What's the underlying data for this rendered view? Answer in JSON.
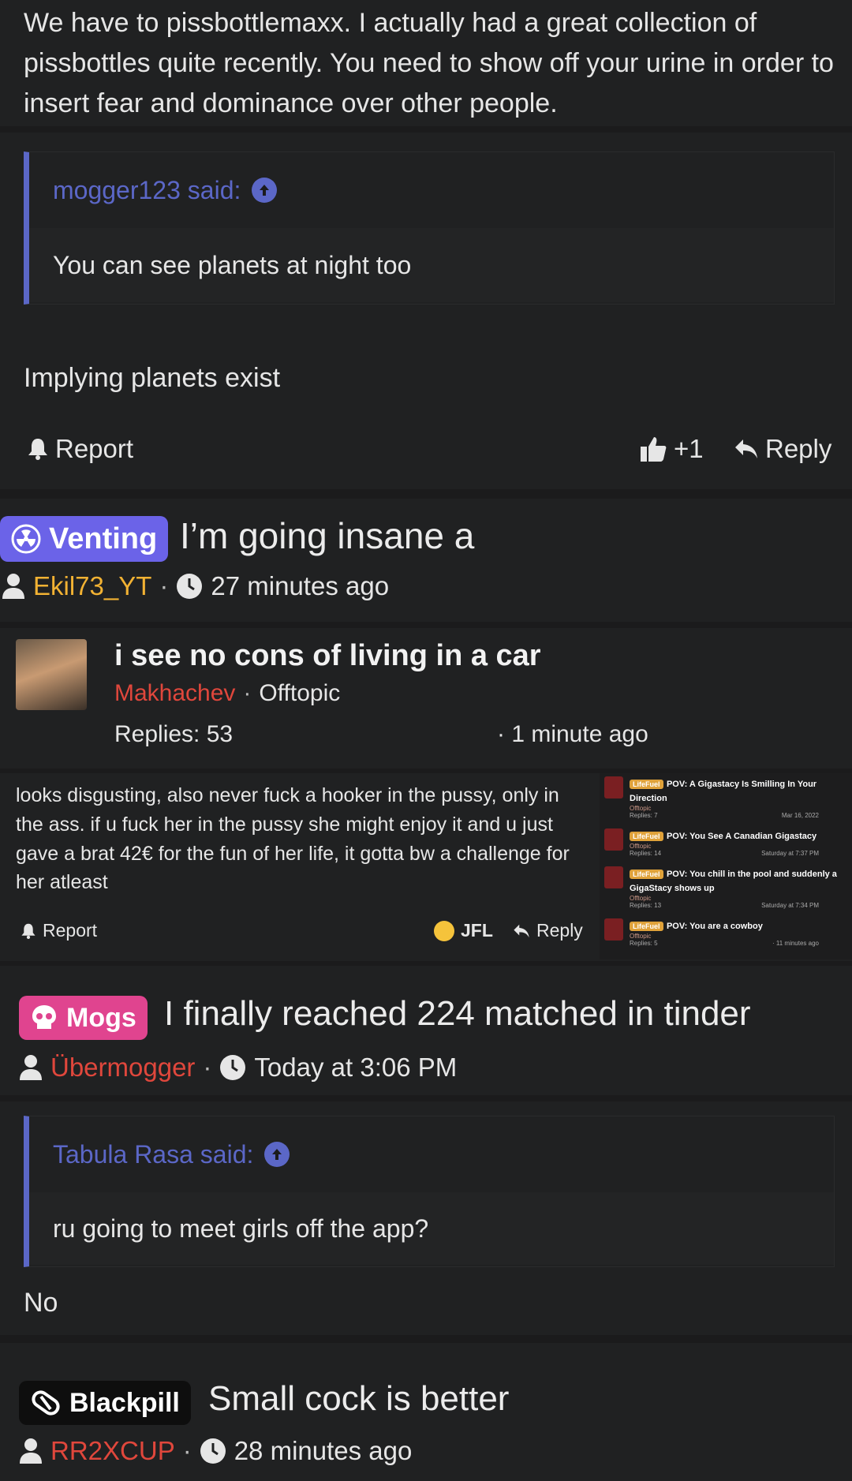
{
  "post1": {
    "text": "We have to pissbottlemaxx. I actually had a great collection of pissbottles quite recently. You need to show off your urine in order to insert fear and dominance over other people."
  },
  "post2": {
    "quote_author": "mogger123 said:",
    "quote_text": "You can see planets at night too",
    "body": "Implying planets exist",
    "report_label": "Report",
    "reaction_count": "+1",
    "reply_label": "Reply"
  },
  "thread1": {
    "tag": "Venting",
    "title": "I’m going insane a",
    "user": "Ekil73_YT",
    "time": "27 minutes ago"
  },
  "thread2": {
    "title": "i see no cons of living in a car",
    "user": "Makhachev",
    "forum": "Offtopic",
    "replies": "Replies: 53",
    "time": "· 1 minute ago"
  },
  "post3": {
    "text": "looks disgusting, also never fuck a hooker in the pussy, only in the ass. if u fuck her in the pussy she might enjoy it and u just gave a brat 42€ for the fun of her life, it gotta bw a challenge for her atleast",
    "report_label": "Report",
    "reaction_label": "JFL",
    "reply_label": "Reply"
  },
  "embedded_list": [
    {
      "tag": "LifeFuel",
      "title": "POV: A Gigastacy Is Smilling In Your Direction",
      "forum": "Offtopic",
      "replies": "Replies: 7",
      "time": "Mar 16, 2022"
    },
    {
      "tag": "LifeFuel",
      "title": "POV: You See A Canadian Gigastacy",
      "forum": "Offtopic",
      "replies": "Replies: 14",
      "time": "Saturday at 7:37 PM"
    },
    {
      "tag": "LifeFuel",
      "title": "POV: You chill in the pool and suddenly a GigaStacy shows up",
      "forum": "Offtopic",
      "replies": "Replies: 13",
      "time": "Saturday at 7:34 PM"
    },
    {
      "tag": "LifeFuel",
      "title": "POV: You are a cowboy",
      "forum": "Offtopic",
      "replies": "Replies: 5",
      "time": "· 11 minutes ago"
    }
  ],
  "thread3": {
    "tag": "Mogs",
    "title": "I finally reached 224 matched in tinder",
    "user": "Übermogger",
    "time": "Today at 3:06 PM"
  },
  "post4": {
    "quote_author": "Tabula Rasa said:",
    "quote_text": "ru going to meet girls off the app?",
    "body": "No"
  },
  "thread4": {
    "tag": "Blackpill",
    "title": "Small cock is better",
    "user": "RR2XCUP",
    "time": "28 minutes ago"
  },
  "colors": {
    "quote_accent": "#5b67c7",
    "venting_tag": "#6b63e8",
    "mogs_tag": "#e0448f",
    "blackpill_tag": "#0e0e0e",
    "username_red": "#e0473c",
    "username_yellow": "#f2b233"
  }
}
